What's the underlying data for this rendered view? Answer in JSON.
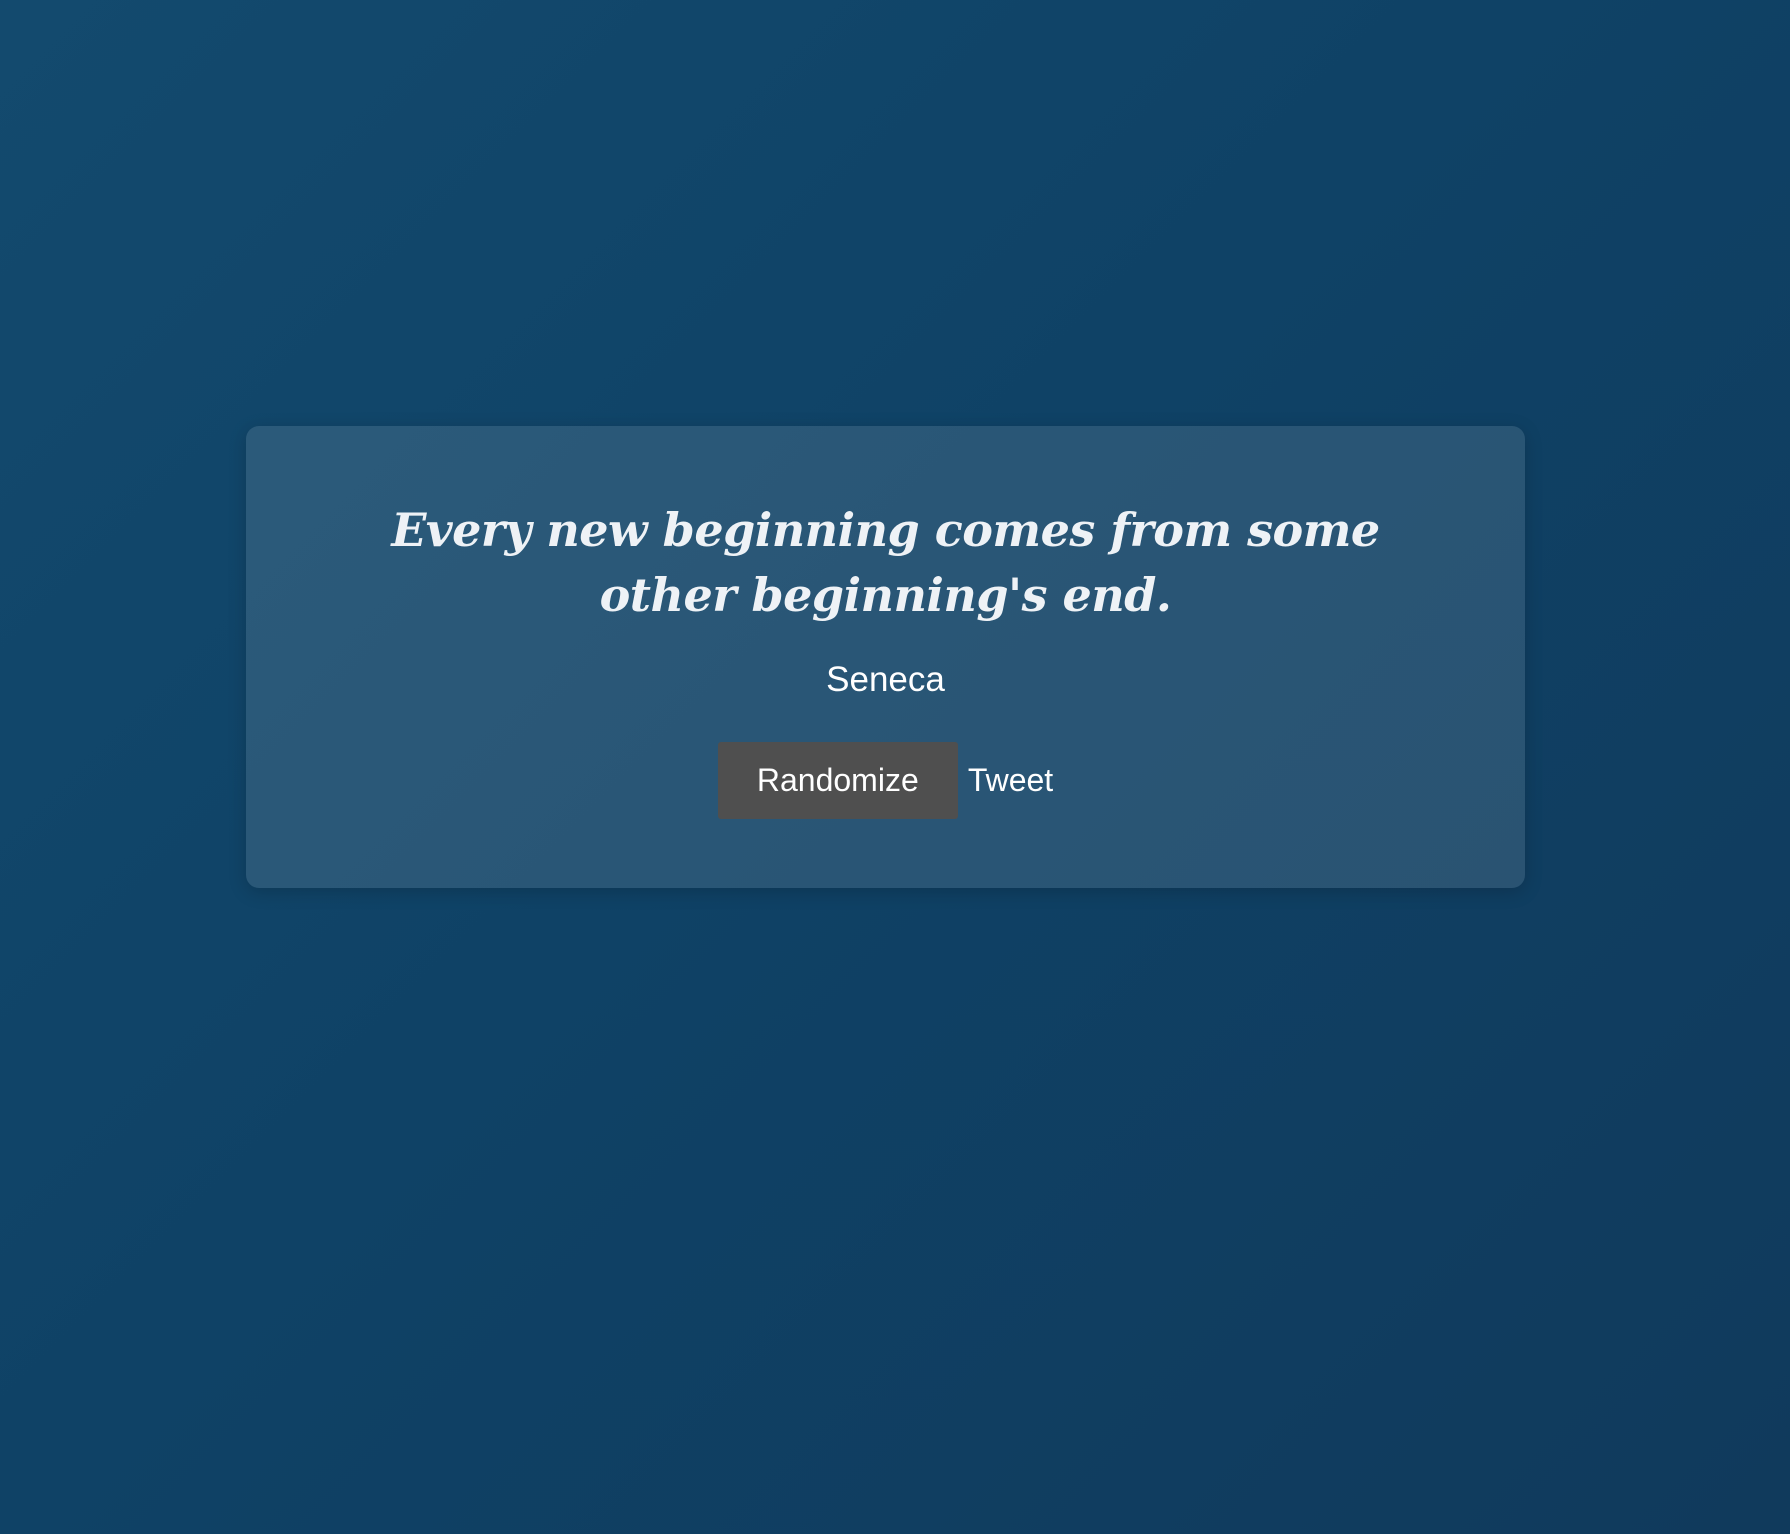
{
  "quote": {
    "text": "Every new beginning comes from some other beginning's end.",
    "author": "Seneca"
  },
  "actions": {
    "randomize_label": "Randomize",
    "tweet_label": "Tweet"
  },
  "colors": {
    "background": "#0f4266",
    "card": "#295a7c",
    "button": "#4f4f4f",
    "text": "#ffffff"
  }
}
